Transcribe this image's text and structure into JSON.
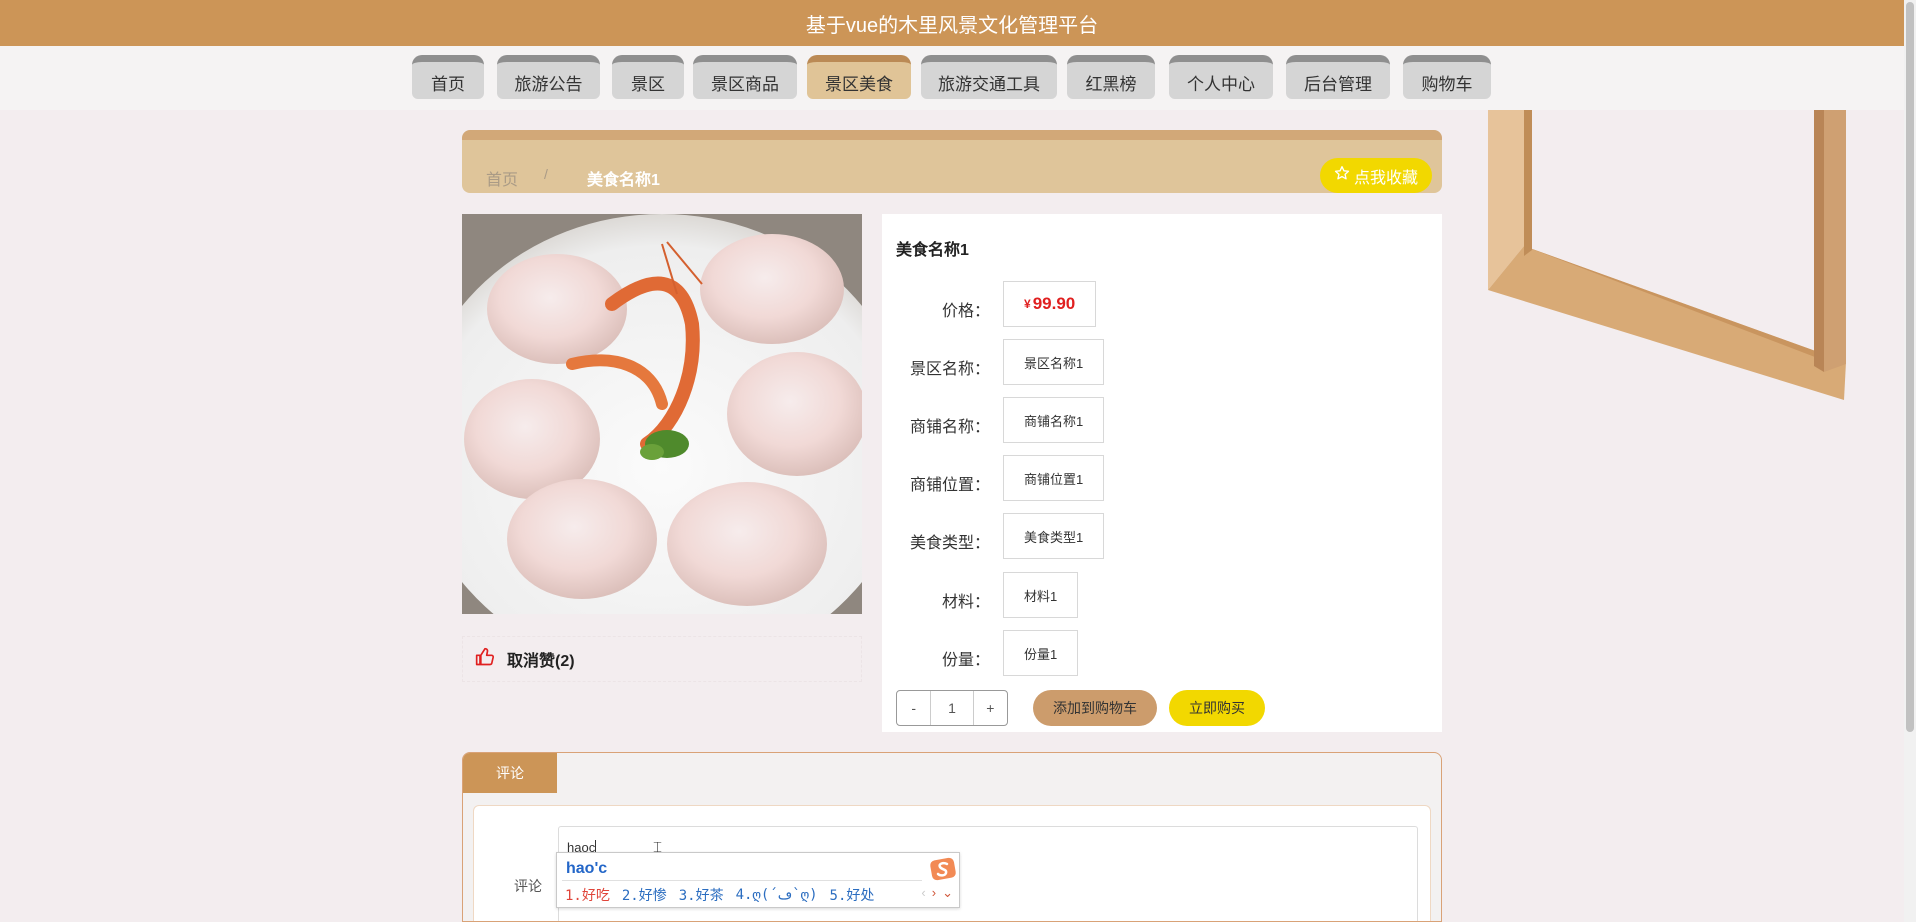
{
  "header": {
    "title": "基于vue的木里风景文化管理平台"
  },
  "nav": {
    "items": [
      {
        "label": "首页"
      },
      {
        "label": "旅游公告"
      },
      {
        "label": "景区"
      },
      {
        "label": "景区商品"
      },
      {
        "label": "景区美食",
        "active": true
      },
      {
        "label": "旅游交通工具"
      },
      {
        "label": "红黑榜"
      },
      {
        "label": "个人中心"
      },
      {
        "label": "后台管理"
      },
      {
        "label": "购物车"
      }
    ]
  },
  "breadcrumb": {
    "home": "首页",
    "separator": "/",
    "current": "美食名称1"
  },
  "favorite_button": {
    "label": "点我收藏",
    "icon": "star-icon"
  },
  "like": {
    "label": "取消赞(2)",
    "icon": "thumbs-up-icon"
  },
  "detail": {
    "title": "美食名称1",
    "price": {
      "label": "价格：",
      "currency": "¥",
      "value": "99.90"
    },
    "rows": [
      {
        "label": "景区名称：",
        "value": "景区名称1"
      },
      {
        "label": "商铺名称：",
        "value": "商铺名称1"
      },
      {
        "label": "商铺位置：",
        "value": "商铺位置1"
      },
      {
        "label": "美食类型：",
        "value": "美食类型1"
      },
      {
        "label": "材料：",
        "value": "材料1"
      },
      {
        "label": "份量：",
        "value": "份量1"
      }
    ]
  },
  "cart": {
    "minus": "-",
    "quantity": "1",
    "plus": "+",
    "add_label": "添加到购物车",
    "buy_label": "立即购买"
  },
  "comments": {
    "tab_label": "评论",
    "field_label": "评论",
    "input_value": "haoc"
  },
  "ime": {
    "composition": "hao'c",
    "candidates": [
      "1.好吃",
      "2.好惨",
      "3.好茶",
      "4.ღ(´ڡ`ღ)",
      "5.好处"
    ],
    "prev": "‹",
    "next": "›",
    "expand": "⌄"
  },
  "colors": {
    "header_bg": "#cc9557",
    "accent_yellow": "#f2d800",
    "price_red": "#e02020",
    "active_nav": "#e0c497"
  }
}
